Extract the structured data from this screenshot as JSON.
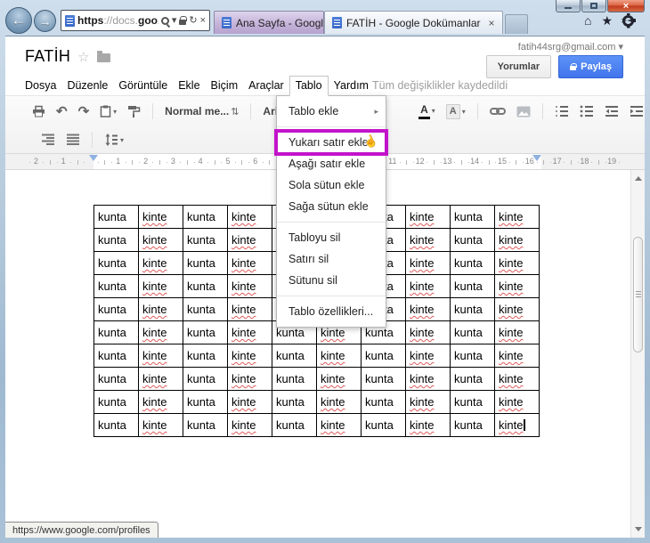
{
  "browser": {
    "address": {
      "scheme": "https",
      "dim": "://docs.",
      "host": "goo..."
    },
    "tabs": [
      {
        "label": "Ana Sayfa - Google Dokümanlar"
      },
      {
        "label": "FATİH - Google Dokümanlar"
      }
    ]
  },
  "header": {
    "title": "FATİH",
    "account_email": "fatih44srg@gmail.com",
    "comments_label": "Yorumlar",
    "share_label": "Paylaş",
    "saved_status": "Tüm değişiklikler kaydedildi"
  },
  "menubar": {
    "items": [
      "Dosya",
      "Düzenle",
      "Görüntüle",
      "Ekle",
      "Biçim",
      "Araçlar",
      "Tablo",
      "Yardım"
    ],
    "open_item": "Tablo"
  },
  "toolbar": {
    "style_label": "Normal me...",
    "font_label": "Arial",
    "text_color_letter": "A",
    "highlight_letter": "A"
  },
  "table_menu": {
    "items": [
      {
        "label": "Tablo ekle",
        "submenu": true
      },
      {
        "separator": true
      },
      {
        "label": "Yukarı satır ekle",
        "highlighted": true
      },
      {
        "label": "Aşağı satır ekle"
      },
      {
        "label": "Sola sütun ekle"
      },
      {
        "label": "Sağa sütun ekle"
      },
      {
        "separator": true
      },
      {
        "label": "Tabloyu sil"
      },
      {
        "label": "Satırı sil"
      },
      {
        "label": "Sütunu sil"
      },
      {
        "separator": true
      },
      {
        "label": "Tablo özellikleri..."
      }
    ],
    "highlight_color": "#c214ca"
  },
  "ruler": {
    "start": -2,
    "end": 19
  },
  "document_table": {
    "rows": 10,
    "cols": 10,
    "pattern": [
      "kunta",
      "kinte"
    ],
    "misspelled_word": "kinte",
    "cursor_in_last_cell": true
  },
  "statusbar": {
    "link_preview": "https://www.google.com/profiles"
  },
  "icons": {
    "back": "←",
    "forward": "→",
    "caret_down": "▾",
    "caret_right": "▸",
    "refresh": "↻",
    "stop": "×",
    "tab_close": "×",
    "window_close": "×",
    "home": "⌂",
    "star_filled": "★",
    "star_outline": "☆",
    "updown": "⇅",
    "undo": "↶",
    "redo": "↷",
    "hand": "☝",
    "email_caret": "▾"
  },
  "colors": {
    "accent_blue": "#4d90fe",
    "highlight_magenta": "#c214ca",
    "spellcheck_red": "#e05b5b"
  }
}
